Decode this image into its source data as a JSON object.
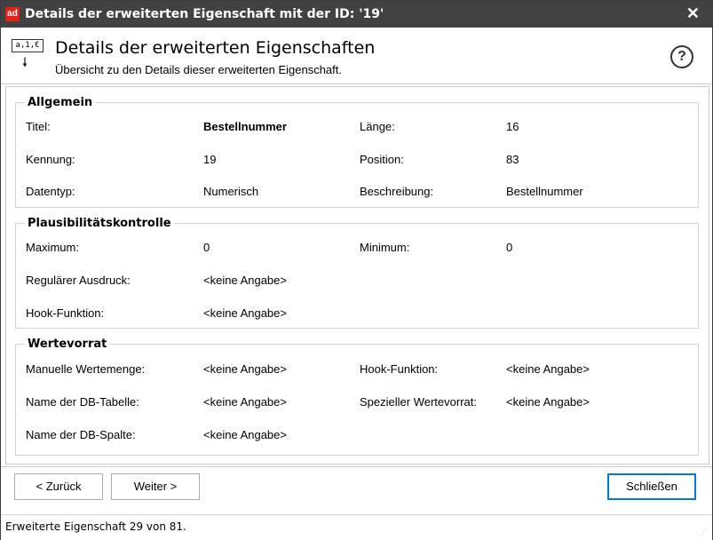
{
  "window": {
    "title": "Details der erweiterten Eigenschaft mit der ID:  '19'",
    "close_glyph": "✕",
    "app_icon_text": "ad"
  },
  "header": {
    "icon": {
      "box_text": "a,1,€",
      "arrow": "🠗"
    },
    "title": "Details der erweiterten Eigenschaften",
    "subtitle": "Übersicht zu den Details dieser erweiterten Eigenschaft.",
    "help_glyph": "?"
  },
  "sections": {
    "allgemein": {
      "legend": "Allgemein",
      "titel_label": "Titel:",
      "titel_value": "Bestellnummer",
      "laenge_label": "Länge:",
      "laenge_value": "16",
      "kennung_label": "Kennung:",
      "kennung_value": "19",
      "position_label": "Position:",
      "position_value": "83",
      "datentyp_label": "Datentyp:",
      "datentyp_value": "Numerisch",
      "beschreibung_label": "Beschreibung:",
      "beschreibung_value": "Bestellnummer"
    },
    "plausi": {
      "legend": "Plausibilitätskontrolle",
      "maximum_label": "Maximum:",
      "maximum_value": "0",
      "minimum_label": "Minimum:",
      "minimum_value": "0",
      "regex_label": "Regulärer Ausdruck:",
      "regex_value": "<keine Angabe>",
      "hook_label": "Hook-Funktion:",
      "hook_value": "<keine Angabe>"
    },
    "werte": {
      "legend": "Wertevorrat",
      "manuell_label": "Manuelle Wertemenge:",
      "manuell_value": "<keine Angabe>",
      "hook_label": "Hook-Funktion:",
      "hook_value": "<keine Angabe>",
      "dbtab_label": "Name der DB-Tabelle:",
      "dbtab_value": "<keine Angabe>",
      "spez_label": "Spezieller Wertevorrat:",
      "spez_value": "<keine Angabe>",
      "dbspalte_label": "Name der DB-Spalte:",
      "dbspalte_value": "<keine Angabe>"
    }
  },
  "buttons": {
    "back": "< Zurück",
    "next": "Weiter >",
    "close": "Schließen"
  },
  "status": {
    "text": "Erweiterte Eigenschaft 29 von 81."
  },
  "colors": {
    "titlebar": "#424242",
    "accent": "#0078d7",
    "brand_red": "#e2231a"
  }
}
